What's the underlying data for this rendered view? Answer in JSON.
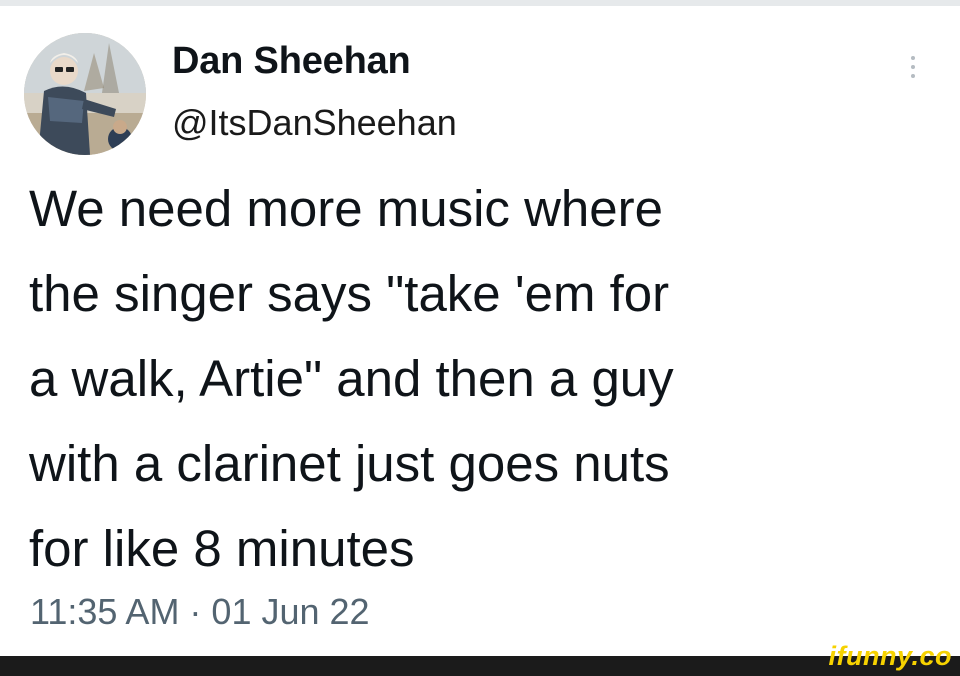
{
  "tweet": {
    "author": {
      "display_name": "Dan Sheehan",
      "handle": "@ItsDanSheehan",
      "avatar_icon": "profile-photo"
    },
    "text": "We need more music where\nthe singer says \"take 'em for\na walk, Artie\" and then a guy\nwith a clarinet just goes nuts\nfor like 8 minutes",
    "timestamp": "11:35 AM · 01 Jun 22",
    "menu_icon": "more-vertical-icon"
  },
  "watermark": {
    "text": "ifunny.co",
    "color": "#f6d200"
  },
  "colors": {
    "text_primary": "#0f1419",
    "text_secondary": "#536471",
    "background": "#ffffff",
    "bottom_bar": "#1b1b1b"
  }
}
